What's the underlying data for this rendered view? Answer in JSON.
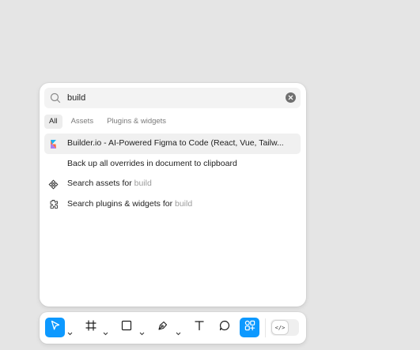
{
  "search": {
    "query": "build",
    "icon": "search-icon",
    "clear_icon": "clear-icon"
  },
  "tabs": [
    {
      "label": "All",
      "active": true
    },
    {
      "label": "Assets",
      "active": false
    },
    {
      "label": "Plugins & widgets",
      "active": false
    }
  ],
  "results": [
    {
      "icon": "builder-io-logo-icon",
      "text": "Builder.io - AI-Powered Figma to Code (React, Vue, Tailw...",
      "suffix": "",
      "selected": true
    },
    {
      "icon": "",
      "text": "Back up all overrides in document to clipboard",
      "suffix": "",
      "selected": false
    },
    {
      "icon": "component-icon",
      "text": "Search assets for ",
      "suffix": "build",
      "selected": false
    },
    {
      "icon": "plugin-icon",
      "text": "Search plugins & widgets for ",
      "suffix": "build",
      "selected": false
    }
  ],
  "toolbar": {
    "tools": [
      {
        "name": "move-tool",
        "icon": "cursor-icon",
        "active": true
      },
      {
        "name": "frame-tool",
        "icon": "frame-icon",
        "active": false
      },
      {
        "name": "shape-tool",
        "icon": "rectangle-icon",
        "active": false
      },
      {
        "name": "pen-tool",
        "icon": "pen-icon",
        "active": false
      },
      {
        "name": "text-tool",
        "icon": "text-icon",
        "active": false
      },
      {
        "name": "comment-tool",
        "icon": "comment-icon",
        "active": false
      },
      {
        "name": "actions-tool",
        "icon": "actions-icon",
        "active": true
      }
    ],
    "dev_mode_icon": "code-icon",
    "dev_mode_label": "</>"
  },
  "colors": {
    "accent": "#0d99ff",
    "background": "#e5e5e5",
    "panel": "#ffffff",
    "muted_text": "#9b9b9b"
  }
}
